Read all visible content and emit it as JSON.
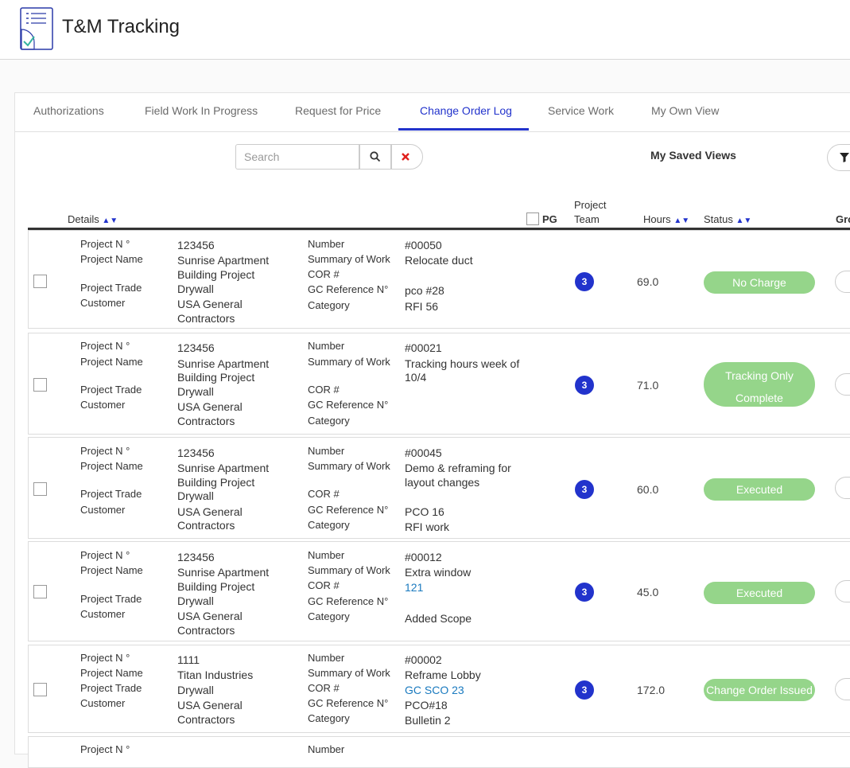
{
  "app": {
    "title": "T&M Tracking"
  },
  "tabs": [
    {
      "label": "Authorizations"
    },
    {
      "label": "Field Work In Progress"
    },
    {
      "label": "Request for Price"
    },
    {
      "label": "Change Order Log"
    },
    {
      "label": "Service Work"
    },
    {
      "label": "My Own View"
    }
  ],
  "search": {
    "placeholder": "Search",
    "value": ""
  },
  "toolbar": {
    "saved_views_label": "My Saved Views"
  },
  "table": {
    "headers": {
      "details": "Details",
      "pg": "PG",
      "project_team_line1": "Project",
      "project_team_line2": "Team",
      "hours": "Hours",
      "status": "Status",
      "group": "Gro"
    },
    "field_labels": {
      "project_no": "Project N °",
      "project_name": "Project Name",
      "project_trade": "Project Trade",
      "customer": "Customer",
      "number": "Number",
      "summary": "Summary of Work",
      "cor": "COR #",
      "gc_ref": "GC Reference N°",
      "category": "Category"
    },
    "rows": [
      {
        "project_no": "123456",
        "project_name_1": "Sunrise Apartment",
        "project_name_2": "Building Project",
        "project_trade": "Drywall",
        "customer_1": "USA General",
        "customer_2": "Contractors",
        "number": "#00050",
        "summary_1": "Relocate duct",
        "summary_2": "",
        "cor": "",
        "gc_ref": "pco #28",
        "category": "RFI 56",
        "team_count": "3",
        "hours": "69.0",
        "status_1": "No Charge",
        "status_2": ""
      },
      {
        "project_no": "123456",
        "project_name_1": "Sunrise Apartment",
        "project_name_2": "Building Project",
        "project_trade": "Drywall",
        "customer_1": "USA General",
        "customer_2": "Contractors",
        "number": "#00021",
        "summary_1": "Tracking hours week of",
        "summary_2": "10/4",
        "cor": "",
        "gc_ref": "",
        "category": "",
        "team_count": "3",
        "hours": "71.0",
        "status_1": "Tracking Only",
        "status_2": "Complete"
      },
      {
        "project_no": "123456",
        "project_name_1": "Sunrise Apartment",
        "project_name_2": "Building Project",
        "project_trade": "Drywall",
        "customer_1": "USA General",
        "customer_2": "Contractors",
        "number": "#00045",
        "summary_1": "Demo & reframing for",
        "summary_2": "layout changes",
        "cor": "",
        "gc_ref": "PCO 16",
        "category": "RFI work",
        "team_count": "3",
        "hours": "60.0",
        "status_1": "Executed",
        "status_2": ""
      },
      {
        "project_no": "123456",
        "project_name_1": "Sunrise Apartment",
        "project_name_2": "Building Project",
        "project_trade": "Drywall",
        "customer_1": "USA General",
        "customer_2": "Contractors",
        "number": "#00012",
        "summary_1": "Extra window",
        "summary_2": "",
        "cor": "121",
        "gc_ref": "",
        "category": "Added Scope",
        "team_count": "3",
        "hours": "45.0",
        "status_1": "Executed",
        "status_2": ""
      },
      {
        "project_no": "1111",
        "project_name_1": "Titan Industries",
        "project_name_2": "",
        "project_trade": "Drywall",
        "customer_1": "USA General",
        "customer_2": "Contractors",
        "number": "#00002",
        "summary_1": "Reframe Lobby",
        "summary_2": "",
        "cor": "GC SCO 23",
        "gc_ref": "PCO#18",
        "category": "Bulletin 2",
        "team_count": "3",
        "hours": "172.0",
        "status_1": "Change Order Issued",
        "status_2": ""
      }
    ]
  },
  "colors": {
    "accent": "#2233cc",
    "status_green": "#95d58a",
    "link_blue": "#1a7abf",
    "logo_teal": "#35b3a0"
  }
}
